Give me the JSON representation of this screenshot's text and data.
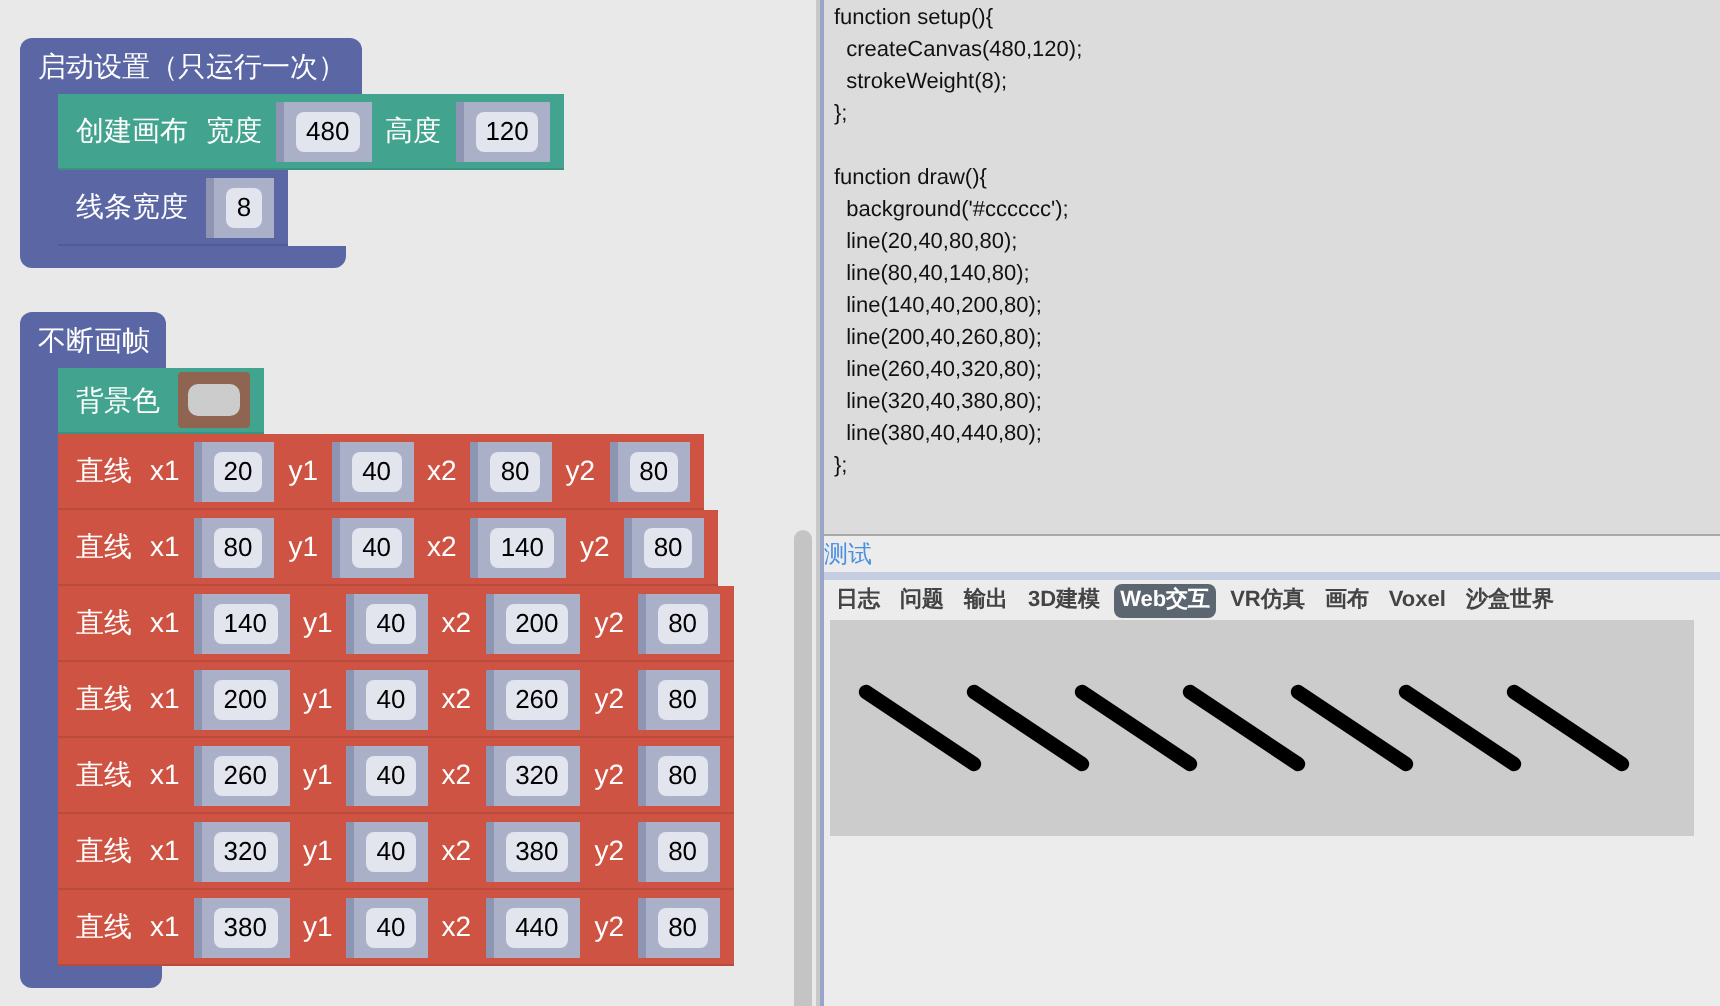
{
  "workspace": {
    "stacks": [
      {
        "title": "启动设置（只运行一次）",
        "blocks": [
          {
            "kind": "canvas",
            "label": "创建画布",
            "fields": [
              {
                "label": "宽度",
                "value": "480"
              },
              {
                "label": "高度",
                "value": "120"
              }
            ]
          },
          {
            "kind": "style",
            "label": "线条宽度",
            "fields": [
              {
                "value": "8"
              }
            ]
          }
        ]
      },
      {
        "title": "不断画帧",
        "blocks": [
          {
            "kind": "background",
            "label": "背景色",
            "color": "#cccccc"
          },
          {
            "kind": "line",
            "label": "直线",
            "fields": [
              {
                "label": "x1",
                "value": "20"
              },
              {
                "label": "y1",
                "value": "40"
              },
              {
                "label": "x2",
                "value": "80"
              },
              {
                "label": "y2",
                "value": "80"
              }
            ]
          },
          {
            "kind": "line",
            "label": "直线",
            "fields": [
              {
                "label": "x1",
                "value": "80"
              },
              {
                "label": "y1",
                "value": "40"
              },
              {
                "label": "x2",
                "value": "140"
              },
              {
                "label": "y2",
                "value": "80"
              }
            ]
          },
          {
            "kind": "line",
            "label": "直线",
            "fields": [
              {
                "label": "x1",
                "value": "140"
              },
              {
                "label": "y1",
                "value": "40"
              },
              {
                "label": "x2",
                "value": "200"
              },
              {
                "label": "y2",
                "value": "80"
              }
            ]
          },
          {
            "kind": "line",
            "label": "直线",
            "fields": [
              {
                "label": "x1",
                "value": "200"
              },
              {
                "label": "y1",
                "value": "40"
              },
              {
                "label": "x2",
                "value": "260"
              },
              {
                "label": "y2",
                "value": "80"
              }
            ]
          },
          {
            "kind": "line",
            "label": "直线",
            "fields": [
              {
                "label": "x1",
                "value": "260"
              },
              {
                "label": "y1",
                "value": "40"
              },
              {
                "label": "x2",
                "value": "320"
              },
              {
                "label": "y2",
                "value": "80"
              }
            ]
          },
          {
            "kind": "line",
            "label": "直线",
            "fields": [
              {
                "label": "x1",
                "value": "320"
              },
              {
                "label": "y1",
                "value": "40"
              },
              {
                "label": "x2",
                "value": "380"
              },
              {
                "label": "y2",
                "value": "80"
              }
            ]
          },
          {
            "kind": "line",
            "label": "直线",
            "fields": [
              {
                "label": "x1",
                "value": "380"
              },
              {
                "label": "y1",
                "value": "40"
              },
              {
                "label": "x2",
                "value": "440"
              },
              {
                "label": "y2",
                "value": "80"
              }
            ]
          }
        ]
      }
    ]
  },
  "code": [
    [
      "function setup(){",
      "  createCanvas(480,120);",
      "  strokeWeight(8);",
      "};"
    ],
    [
      "function draw(){",
      "  background('#cccccc');",
      "  line(20,40,80,80);",
      "  line(80,40,140,80);",
      "  line(140,40,200,80);",
      "  line(200,40,260,80);",
      "  line(260,40,320,80);",
      "  line(320,40,380,80);",
      "  line(380,40,440,80);",
      "};"
    ]
  ],
  "test_link": "测试",
  "tabs": [
    {
      "label": "日志",
      "selected": false
    },
    {
      "label": "问题",
      "selected": false
    },
    {
      "label": "输出",
      "selected": false
    },
    {
      "label": "3D建模",
      "selected": false
    },
    {
      "label": "Web交互",
      "selected": true
    },
    {
      "label": "VR仿真",
      "selected": false
    },
    {
      "label": "画布",
      "selected": false
    },
    {
      "label": "Voxel",
      "selected": false
    },
    {
      "label": "沙盒世界",
      "selected": false
    }
  ]
}
